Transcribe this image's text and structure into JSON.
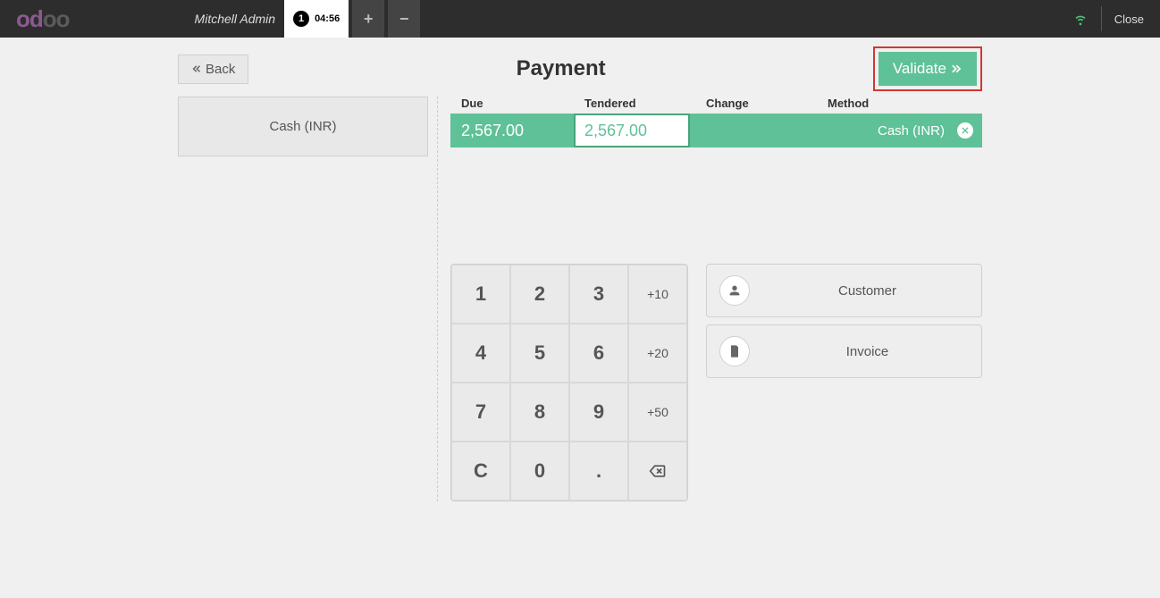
{
  "topbar": {
    "username": "Mitchell Admin",
    "tab_number": "1",
    "tab_time": "04:56",
    "close_label": "Close"
  },
  "header": {
    "back_label": "Back",
    "title": "Payment",
    "validate_label": "Validate"
  },
  "left": {
    "method_label": "Cash (INR)"
  },
  "summary": {
    "headers": {
      "due": "Due",
      "tendered": "Tendered",
      "change": "Change",
      "method": "Method"
    },
    "line": {
      "due": "2,567.00",
      "tendered": "2,567.00",
      "change": "",
      "method": "Cash (INR)"
    }
  },
  "keypad": {
    "k1": "1",
    "k2": "2",
    "k3": "3",
    "p10": "+10",
    "k4": "4",
    "k5": "5",
    "k6": "6",
    "p20": "+20",
    "k7": "7",
    "k8": "8",
    "k9": "9",
    "p50": "+50",
    "clear": "C",
    "k0": "0",
    "dot": "."
  },
  "side": {
    "customer_label": "Customer",
    "invoice_label": "Invoice"
  }
}
